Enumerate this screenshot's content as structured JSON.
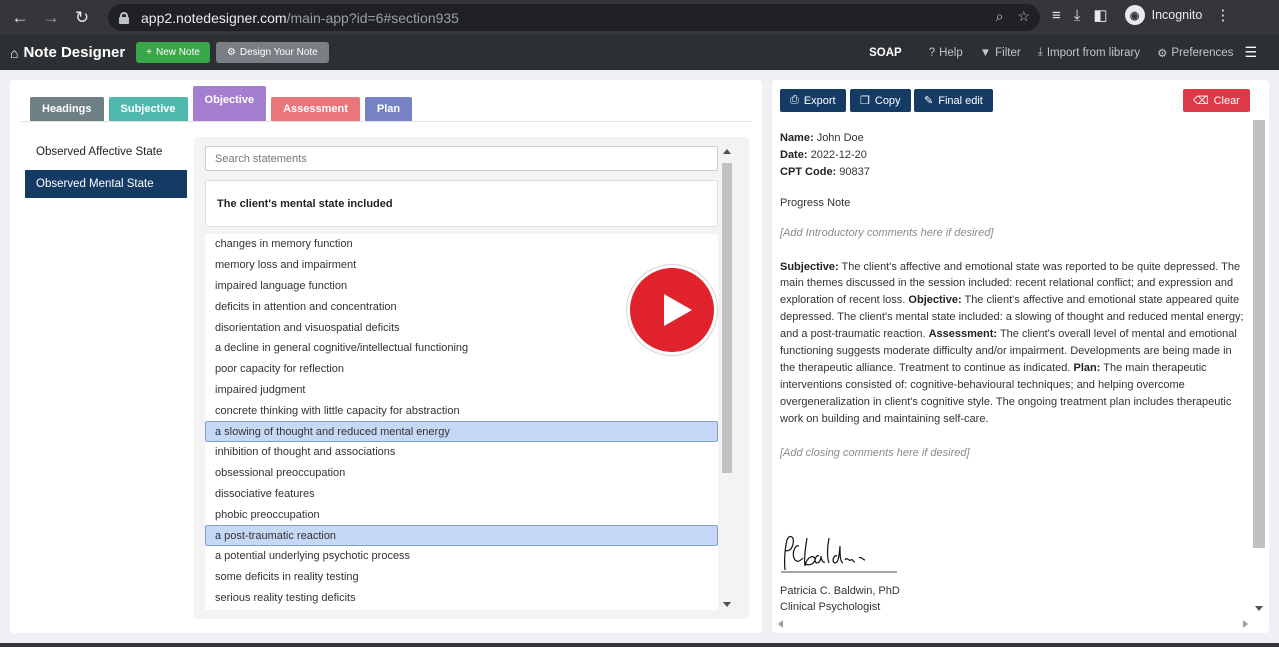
{
  "browser": {
    "url_host": "app2.notedesigner.com",
    "url_path": "/main-app?id=6#section935",
    "profile_label": "Incognito"
  },
  "appbar": {
    "brand": "Note Designer",
    "new_note": "New Note",
    "design_note": "Design Your Note",
    "soap": "SOAP",
    "help": "Help",
    "filter": "Filter",
    "import": "Import from library",
    "preferences": "Preferences"
  },
  "tabs": [
    {
      "label": "Headings"
    },
    {
      "label": "Subjective"
    },
    {
      "label": "Objective"
    },
    {
      "label": "Assessment"
    },
    {
      "label": "Plan"
    }
  ],
  "headings": [
    {
      "label": "Observed Affective State"
    },
    {
      "label": "Observed Mental State"
    }
  ],
  "statements": {
    "search_placeholder": "Search statements",
    "stem": "The client's mental state included",
    "items": [
      "changes in memory function",
      "memory loss and impairment",
      "impaired language function",
      "deficits in attention and concentration",
      "disorientation and visuospatial deficits",
      "a decline in general cognitive/intellectual functioning",
      "poor capacity for reflection",
      "impaired judgment",
      "concrete thinking with little capacity for abstraction",
      "a slowing of thought and reduced mental energy",
      "inhibition of thought and associations",
      "obsessional preoccupation",
      "dissociative features",
      "phobic preoccupation",
      "a post-traumatic reaction",
      "a potential underlying psychotic process",
      "some deficits in reality testing",
      "serious reality testing deficits"
    ]
  },
  "note_toolbar": {
    "export": "Export",
    "copy": "Copy",
    "final_edit": "Final edit",
    "clear": "Clear"
  },
  "note": {
    "name_label": "Name:",
    "name_value": "John Doe",
    "date_label": "Date:",
    "date_value": "2022-12-20",
    "cpt_label": "CPT Code:",
    "cpt_value": "90837",
    "title": "Progress Note",
    "intro_placeholder": "[Add Introductory comments here if desired]",
    "subjective_label": "Subjective:",
    "subjective_text": "The client's affective and emotional state was reported to be quite depressed. The main themes discussed in the session included: recent relational conflict; and expression and exploration of recent loss.",
    "objective_label": "Objective:",
    "objective_text": "The client's affective and emotional state appeared quite depressed. The client's mental state included: a slowing of thought and reduced mental energy; and a post-traumatic reaction.",
    "assessment_label": "Assessment:",
    "assessment_text": "The client's overall level of mental and emotional functioning suggests moderate difficulty and/or impairment. Developments are being made in the therapeutic alliance. Treatment to continue as indicated.",
    "plan_label": "Plan:",
    "plan_text": "The main therapeutic interventions consisted of: cognitive-behavioural techniques; and helping overcome overgeneralization in client's cognitive style. The ongoing treatment plan includes therapeutic work on building and maintaining self-care.",
    "closing_placeholder": "[Add closing comments here if desired]",
    "signer_name": "Patricia C. Baldwin, PhD",
    "signer_title": "Clinical Psychologist"
  }
}
